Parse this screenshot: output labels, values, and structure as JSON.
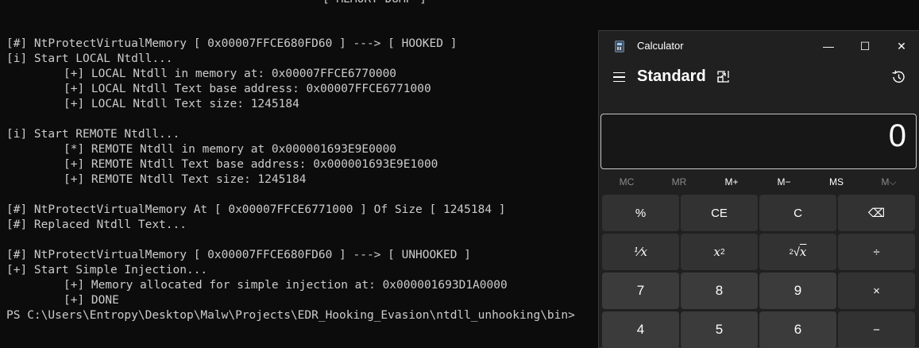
{
  "terminal": {
    "title": "[ MEMORY DUMP ]",
    "lines": [
      "[#] NtProtectVirtualMemory [ 0x00007FFCE680FD60 ] ---> [ HOOKED ]",
      "[i] Start LOCAL Ntdll...",
      "[+] LOCAL Ntdll in memory at: 0x00007FFCE6770000",
      "[+] LOCAL Ntdll Text base address: 0x00007FFCE6771000",
      "[+] LOCAL Ntdll Text size: 1245184",
      "[i] Start REMOTE Ntdll...",
      "[*] REMOTE Ntdll in memory at 0x000001693E9E0000",
      "[+] REMOTE Ntdll Text base address: 0x000001693E9E1000",
      "[+] REMOTE Ntdll Text size: 1245184",
      "[#] NtProtectVirtualMemory At [ 0x00007FFCE6771000 ] Of Size [ 1245184 ]",
      "[#] Replaced Ntdll Text...",
      "[#] NtProtectVirtualMemory [ 0x00007FFCE680FD60 ] ---> [ UNHOOKED ]",
      "[+] Start Simple Injection...",
      "[+] Memory allocated for simple injection at: 0x000001693D1A0000",
      "[+] DONE",
      "PS C:\\Users\\Entropy\\Desktop\\Malw\\Projects\\EDR_Hooking_Evasion\\ntdll_unhooking\\bin>"
    ]
  },
  "calculator": {
    "app_title": "Calculator",
    "mode": "Standard",
    "display": "0",
    "window_buttons": {
      "minimize": "—",
      "maximize": "☐",
      "close": "✕"
    },
    "memory_buttons": [
      "MC",
      "MR",
      "M+",
      "M−",
      "MS",
      "M⌵"
    ],
    "keys": {
      "percent": "%",
      "ce": "CE",
      "clear": "C",
      "backspace": "⌫",
      "reciprocal": "⅟x",
      "square_base": "x",
      "square_exp": "2",
      "sqrt_index": "2",
      "sqrt_sign": "√",
      "sqrt_x": "x",
      "divide": "÷",
      "seven": "7",
      "eight": "8",
      "nine": "9",
      "multiply": "×",
      "four": "4",
      "five": "5",
      "six": "6",
      "minus": "−"
    },
    "colors": {
      "background": "#202020",
      "function_key": "#323232",
      "number_key": "#3b3b3b",
      "display_border": "#c7c7c7"
    }
  }
}
